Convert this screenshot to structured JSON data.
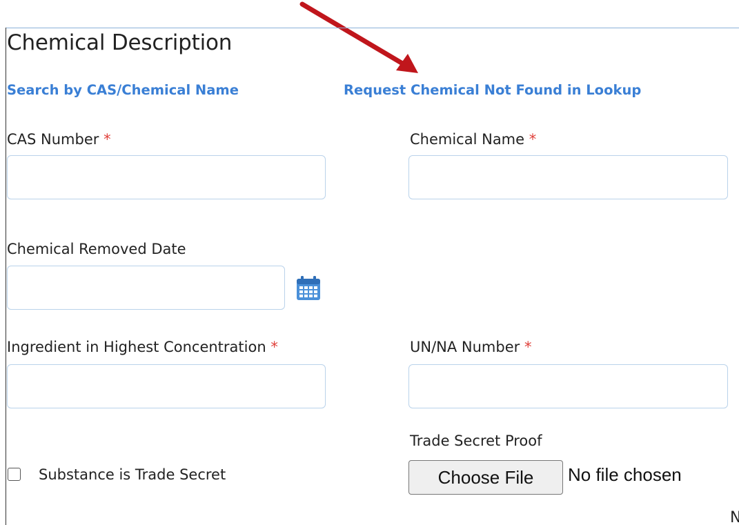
{
  "section": {
    "title": "Chemical Description"
  },
  "links": {
    "search": "Search by CAS/Chemical Name",
    "request": "Request Chemical Not Found in Lookup"
  },
  "fields": {
    "cas_number": {
      "label": "CAS Number",
      "required_mark": "*",
      "value": ""
    },
    "chemical_name": {
      "label": "Chemical Name",
      "required_mark": "*",
      "value": ""
    },
    "removed_date": {
      "label": "Chemical Removed Date",
      "value": ""
    },
    "ingredient_highest": {
      "label": "Ingredient in Highest Concentration",
      "required_mark": "*",
      "value": ""
    },
    "un_na_number": {
      "label": "UN/NA Number",
      "required_mark": "*",
      "value": ""
    },
    "trade_secret_checkbox": {
      "label": "Substance is Trade Secret",
      "checked": false
    },
    "trade_secret_proof": {
      "label": "Trade Secret Proof",
      "button_label": "Choose File",
      "status": "No file chosen"
    }
  },
  "annotation": {
    "arrow_color": "#c0161c"
  },
  "colors": {
    "link": "#3a7fd5",
    "required": "#e0403a",
    "input_border": "#b9d2ea",
    "calendar_icon": "#4a90d9"
  },
  "icons": {
    "calendar": "calendar-icon"
  },
  "clipped_text": "N"
}
